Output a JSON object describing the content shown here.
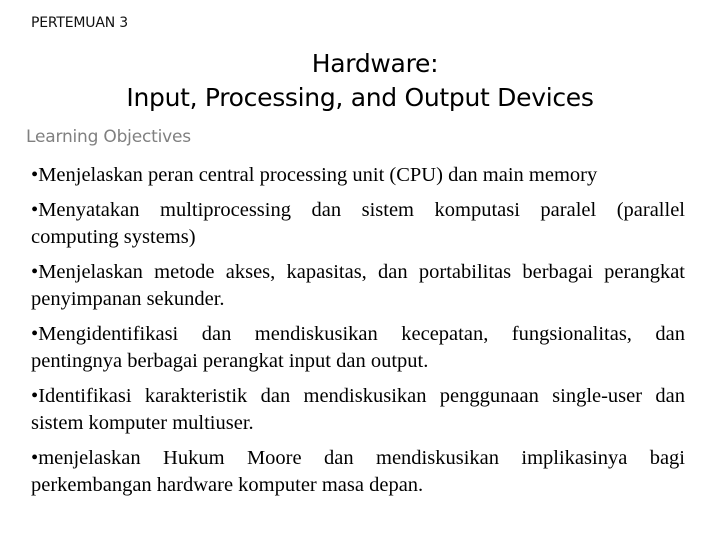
{
  "slide": {
    "meeting_label": "PERTEMUAN 3",
    "title_line1": "Hardware:",
    "title_line2": "Input, Processing, and Output Devices",
    "subtitle": "Learning Objectives",
    "bullet_glyph": "•",
    "objectives": [
      "Menjelaskan peran central processing unit (CPU) dan main memory",
      "Menyatakan multiprocessing dan sistem komputasi paralel (parallel computing systems)",
      "Menjelaskan metode akses, kapasitas, dan portabilitas berbagai perangkat penyimpanan sekunder.",
      "Mengidentifikasi dan mendiskusikan kecepatan, fungsionalitas, dan pentingnya berbagai perangkat input dan output.",
      "Identifikasi karakteristik dan mendiskusikan penggunaan single-user dan sistem komputer multiuser.",
      "menjelaskan Hukum Moore dan mendiskusikan implikasinya bagi perkembangan hardware komputer masa depan."
    ]
  }
}
